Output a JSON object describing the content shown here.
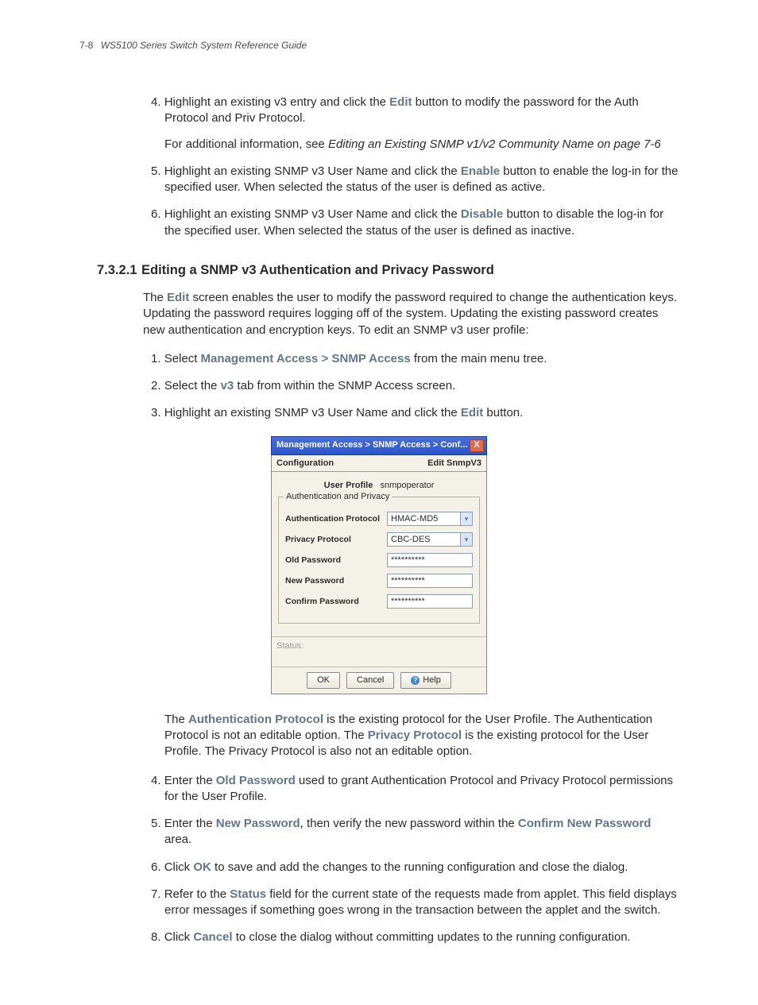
{
  "header": {
    "page": "7-8",
    "title": "WS5100 Series Switch System Reference Guide"
  },
  "sec1": {
    "i4_num": "4.",
    "i4_a": "Highlight an existing v3 entry and click the ",
    "i4_b": "Edit",
    "i4_c": " button to modify the password for the Auth Protocol and Priv Protocol.",
    "i4_extra_a": "For additional information, see ",
    "i4_extra_b": "Editing an Existing SNMP v1/v2 Community Name on page 7-6",
    "i5_num": "5.",
    "i5_a": "Highlight an existing SNMP v3 User Name and click the ",
    "i5_b": "Enable",
    "i5_c": " button to enable the log-in for the specified user. When selected the status of the user is defined as active.",
    "i6_num": "6.",
    "i6_a": "Highlight an existing SNMP v3 User Name and click the ",
    "i6_b": "Disable",
    "i6_c": " button to disable the log-in for the specified user. When selected the status of the user is defined as inactive."
  },
  "heading": {
    "num": "7.3.2.1",
    "title": "Editing a SNMP v3 Authentication and Privacy Password"
  },
  "intro": {
    "a": "The ",
    "b": "Edit",
    "c": " screen enables the user to modify the password required to change the authentication keys. Updating the password requires logging off of the system. Updating the existing password creates new authentication and encryption keys. To edit an SNMP v3 user profile:"
  },
  "steps": {
    "s1_num": "1.",
    "s1_a": "Select ",
    "s1_b": "Management Access > SNMP Access",
    "s1_c": " from the main menu tree.",
    "s2_num": "2.",
    "s2_a": "Select the ",
    "s2_b": "v3",
    "s2_c": " tab from within the SNMP Access screen.",
    "s3_num": "3.",
    "s3_a": "Highlight an existing SNMP v3 User Name and click the ",
    "s3_b": "Edit",
    "s3_c": " button."
  },
  "dialog": {
    "title": "Management Access > SNMP Access > Conf...",
    "sub_left": "Configuration",
    "sub_right": "Edit SnmpV3",
    "profile_label": "User Profile",
    "profile_value": "snmpoperator",
    "legend": "Authentication and Privacy",
    "auth_label": "Authentication Protocol",
    "auth_value": "HMAC-MD5",
    "priv_label": "Privacy Protocol",
    "priv_value": "CBC-DES",
    "oldpw_label": "Old Password",
    "oldpw_value": "**********",
    "newpw_label": "New Password",
    "newpw_value": "**********",
    "confpw_label": "Confirm Password",
    "confpw_value": "**********",
    "status_label": "Status:",
    "btn_ok": "OK",
    "btn_cancel": "Cancel",
    "btn_help": "Help"
  },
  "post": {
    "a": "The ",
    "b": "Authentication Protocol",
    "c": " is the existing protocol for the User Profile. The Authentication Protocol is not an editable option. The ",
    "d": "Privacy Protocol",
    "e": " is the existing protocol for the User Profile. The Privacy Protocol is also not an editable option."
  },
  "steps2": {
    "s4_num": "4.",
    "s4_a": "Enter the ",
    "s4_b": "Old Password",
    "s4_c": " used to grant Authentication Protocol and Privacy Protocol permissions for the User Profile.",
    "s5_num": "5.",
    "s5_a": "Enter the ",
    "s5_b": "New Password",
    "s5_c": ", then verify the new password within the ",
    "s5_d": "Confirm New Password",
    "s5_e": " area.",
    "s6_num": "6.",
    "s6_a": "Click ",
    "s6_b": "OK",
    "s6_c": " to save and add the changes to the running configuration and close the dialog.",
    "s7_num": "7.",
    "s7_a": "Refer to the ",
    "s7_b": "Status",
    "s7_c": " field for the current state of the requests made from applet. This field displays error messages if something goes wrong in the transaction between the applet and the switch.",
    "s8_num": "8.",
    "s8_a": "Click ",
    "s8_b": "Cancel",
    "s8_c": " to close the dialog without committing updates to the running configuration."
  }
}
